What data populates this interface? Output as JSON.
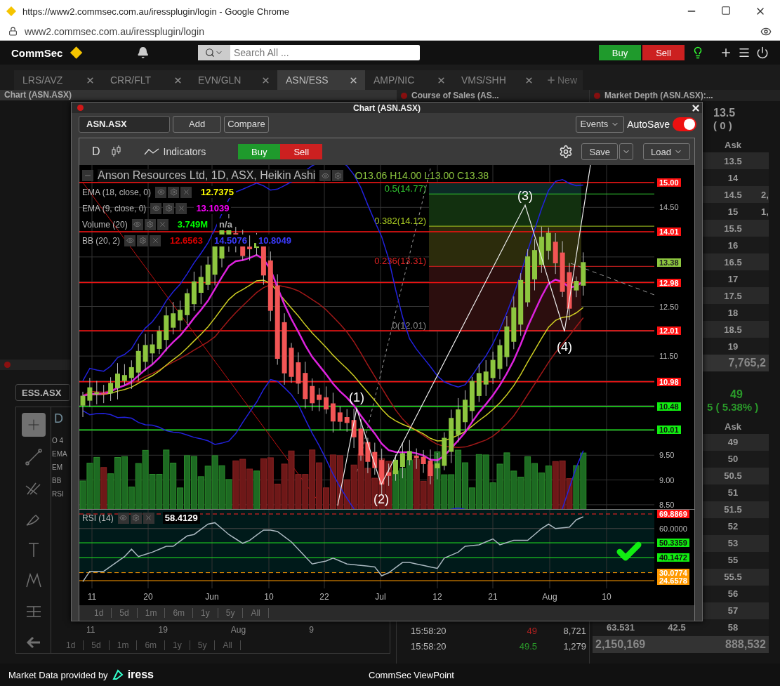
{
  "browser": {
    "title": "https://www2.commsec.com.au/iressplugin/login - Google Chrome",
    "url": "www2.commsec.com.au/iressplugin/login"
  },
  "header": {
    "logo": "CommSec",
    "search": {
      "placeholder": "Search All ..."
    },
    "buttons": [
      {
        "label": "Buy",
        "kind": "buy"
      },
      {
        "label": "Sell",
        "kind": "sell"
      }
    ]
  },
  "tabs": [
    {
      "label": "LRS/AVZ",
      "selected": false
    },
    {
      "label": "CRR/FLT",
      "selected": false
    },
    {
      "label": "EVN/GLN",
      "selected": false
    },
    {
      "label": "ASN/ESS",
      "selected": true
    },
    {
      "label": "AMP/NIC",
      "selected": false
    },
    {
      "label": "VMS/SHH",
      "selected": false
    }
  ],
  "new_tab": "New",
  "panels": [
    {
      "title": "Chart (ASN.ASX)"
    },
    {
      "title": "Course of Sales (AS..."
    },
    {
      "title": "Market Depth (ASN.ASX):..."
    }
  ],
  "background_chart": {
    "symbol": "ESS.ASX",
    "interval": "D",
    "legend": [
      "O 4",
      "EMA",
      "EM",
      "BB"
    ],
    "rsi": "RSI",
    "dates": [
      "11",
      "19",
      "Aug",
      "9"
    ],
    "periods": [
      "1d",
      "5d",
      "1m",
      "6m",
      "1y",
      "5y",
      "All"
    ]
  },
  "course_of_sales": {
    "rows": [
      {
        "time": "15:58:20",
        "price": "49",
        "volume": "8,721",
        "kind": "down"
      },
      {
        "time": "15:58:20",
        "price": "49.5",
        "volume": "1,279",
        "kind": "up"
      }
    ]
  },
  "market_depth": [
    {
      "price": "13.5",
      "change": "( 0 )",
      "header": "Ask",
      "rows": [
        {
          "ask": "13.5"
        },
        {
          "ask": "14"
        },
        {
          "ask": "14.5",
          "column_2": "2,"
        },
        {
          "ask": "15",
          "column_2": "1,"
        },
        {
          "ask": "15.5"
        },
        {
          "ask": "16"
        },
        {
          "ask": "16.5"
        },
        {
          "ask": "17"
        },
        {
          "ask": "17.5"
        },
        {
          "ask": "18"
        },
        {
          "ask": "18.5"
        },
        {
          "ask": "19"
        }
      ],
      "totals": [
        "7,765,2"
      ]
    },
    {
      "price": "49",
      "change": "5 ( 5.38% )",
      "header": "Ask",
      "rows": [
        {
          "ask": "49"
        },
        {
          "ask": "50"
        },
        {
          "ask": "50.5"
        },
        {
          "ask": "51"
        },
        {
          "ask": "51.5"
        },
        {
          "ask": "52"
        },
        {
          "ask": "53"
        },
        {
          "ask": "55"
        },
        {
          "ask": "55.5"
        },
        {
          "ask": "56"
        },
        {
          "ask": "57"
        },
        {
          "column_0": "63.531",
          "column_1": "42.5",
          "ask": "58"
        }
      ],
      "totals": [
        "2,150,169",
        "888,532"
      ]
    }
  ],
  "chart_window": {
    "title": "Chart (ASN.ASX)",
    "symbol": "ASN.ASX",
    "buttons": [
      "Add",
      "Compare"
    ],
    "events": "Events",
    "autosave": {
      "label": "AutoSave",
      "on": true
    },
    "toolbar": {
      "interval": "D",
      "indicators": "Indicators",
      "buy": "Buy",
      "sell": "Sell",
      "save": "Save",
      "load": "Load"
    },
    "legend": {
      "title": "Anson Resources Ltd, 1D, ASX, Heikin Ashi",
      "ohlc": "O13.06 H14.00 L13.00 C13.38",
      "indicators": [
        {
          "name": "EMA (18, close, 0)",
          "values": [
            {
              "text": "12.7375",
              "color": "#ffff00"
            }
          ]
        },
        {
          "name": "EMA (9, close, 0)",
          "values": [
            {
              "text": "13.1039",
              "color": "#ff00ff"
            }
          ]
        },
        {
          "name": "Volume (20)",
          "values": [
            {
              "text": "3.749M",
              "color": "#00ff00"
            },
            {
              "text": "n/a",
              "color": "#aaaaaa"
            }
          ]
        },
        {
          "name": "BB (20, 2)",
          "values": [
            {
              "text": "12.6563",
              "color": "#dd0000"
            },
            {
              "text": "14.5076",
              "color": "#3b3bff"
            },
            {
              "text": "10.8049",
              "color": "#3b3bff"
            }
          ]
        }
      ]
    },
    "fib_levels": [
      {
        "label": "0.5(14.77)",
        "kind": "half"
      },
      {
        "label": "0.382(14.12)",
        "kind": "third"
      },
      {
        "label": "0.236(13.31)",
        "kind": "quarter"
      },
      {
        "label": "0(12.01)",
        "kind": "zero"
      }
    ],
    "waves": [
      "(1)",
      "(2)",
      "(3)",
      "(4)"
    ],
    "price_axis": [
      {
        "text": "15.00",
        "kind": "resistance"
      },
      {
        "text": "14.50",
        "kind": "tick"
      },
      {
        "text": "14.01",
        "kind": "resistance"
      },
      {
        "text": "13.38",
        "kind": "last"
      },
      {
        "text": "12.98",
        "kind": "resistance"
      },
      {
        "text": "12.50",
        "kind": "tick"
      },
      {
        "text": "12.01",
        "kind": "resistance"
      },
      {
        "text": "11.50",
        "kind": "tick"
      },
      {
        "text": "10.98",
        "kind": "resistance"
      },
      {
        "text": "10.48",
        "kind": "support"
      },
      {
        "text": "10.01",
        "kind": "support"
      },
      {
        "text": "9.50",
        "kind": "tick"
      },
      {
        "text": "9.00",
        "kind": "tick"
      },
      {
        "text": "8.50",
        "kind": "tick"
      }
    ],
    "rsi": {
      "name": "RSI (14)",
      "value": "58.4129",
      "axis": [
        {
          "text": "69.8869",
          "kind": "overbought"
        },
        {
          "text": "60.0000",
          "kind": "tick"
        },
        {
          "text": "50.3359",
          "kind": "support"
        },
        {
          "text": "40.1472",
          "kind": "support"
        },
        {
          "text": "30.0774",
          "kind": "oversold"
        },
        {
          "text": "24.6578",
          "kind": "oversold"
        }
      ]
    },
    "dates": [
      "11",
      "20",
      "Jun",
      "10",
      "22",
      "Jul",
      "12",
      "21",
      "Aug",
      "10"
    ],
    "periods": [
      "1d",
      "5d",
      "1m",
      "6m",
      "1y",
      "5y",
      "All"
    ]
  },
  "footer": {
    "provider": "Market Data provided by",
    "provider_logo": "iress",
    "center": "CommSec ViewPoint"
  }
}
